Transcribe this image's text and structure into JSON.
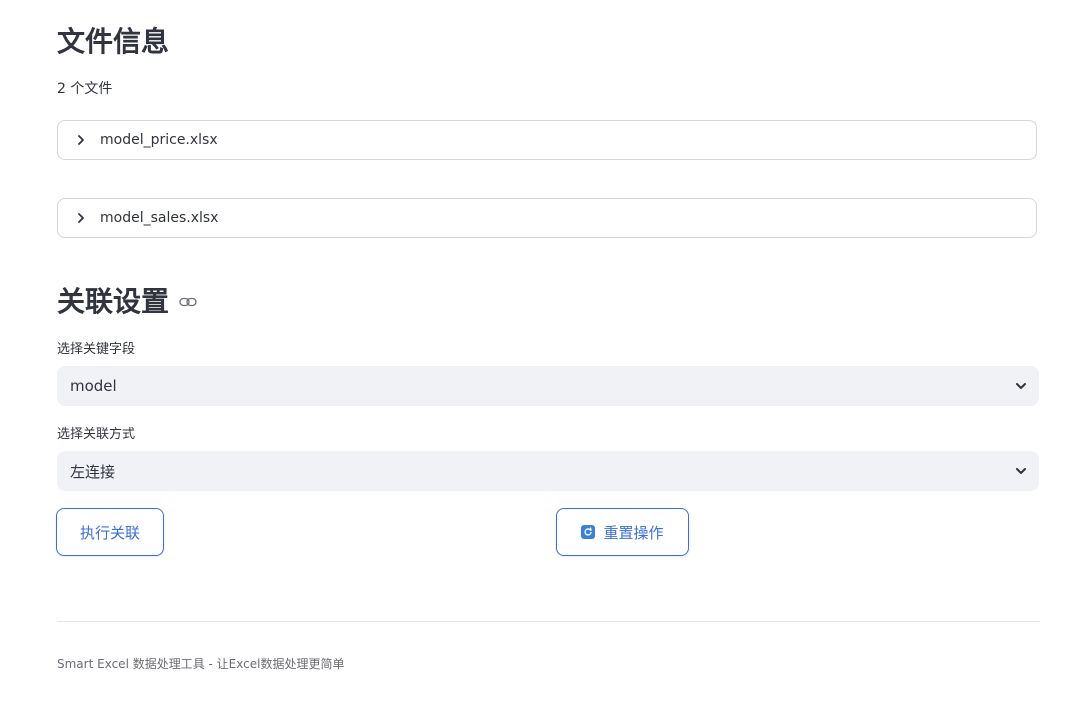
{
  "file_info": {
    "title": "文件信息",
    "count_text": "2 个文件",
    "files": [
      {
        "name": "model_price.xlsx"
      },
      {
        "name": "model_sales.xlsx"
      }
    ]
  },
  "join_settings": {
    "title": "关联设置",
    "key_field": {
      "label": "选择关键字段",
      "value": "model"
    },
    "join_type": {
      "label": "选择关联方式",
      "value": "左连接"
    },
    "execute_label": "执行关联",
    "reset_label": "重置操作"
  },
  "footer": {
    "text": "Smart Excel 数据处理工具 - 让Excel数据处理更简单"
  },
  "colors": {
    "accent": "#3b6fd8",
    "select_bg": "#f0f2f6",
    "text": "#31333f"
  },
  "icons": {
    "expander": "chevron-right-icon",
    "heading_anchor": "link-icon",
    "select_caret": "chevron-down-icon",
    "reset": "refresh-icon"
  }
}
